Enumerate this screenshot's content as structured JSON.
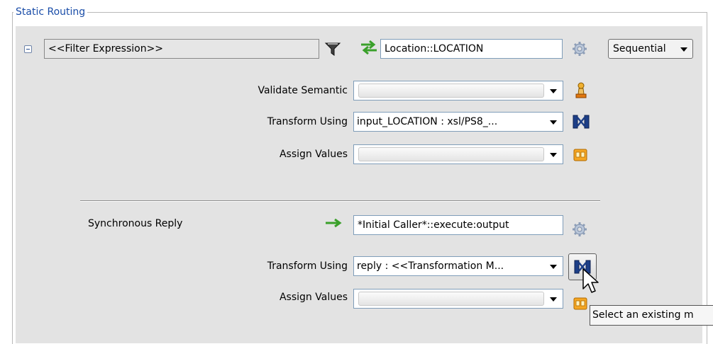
{
  "group": {
    "title": "Static Routing"
  },
  "rule": {
    "filter_expression": "<<Filter Expression>>",
    "target_service": "Location::LOCATION",
    "execution_mode": "Sequential",
    "validate_semantic": {
      "label": "Validate Semantic",
      "value": ""
    },
    "transform": {
      "label": "Transform Using",
      "value": "input_LOCATION : xsl/PS8_..."
    },
    "assign": {
      "label": "Assign Values",
      "value": ""
    }
  },
  "reply": {
    "label": "Synchronous Reply",
    "target": "*Initial Caller*::execute:output",
    "transform": {
      "label": "Transform Using",
      "value": "reply : <<Transformation M..."
    },
    "assign": {
      "label": "Assign Values",
      "value": ""
    }
  },
  "tooltip": {
    "text": "Select an existing m"
  },
  "icons": {
    "collapse": "collapse-toggle-icon",
    "filter": "filter-funnel-icon",
    "route": "green-swap-arrows-icon",
    "settings": "gear-icon",
    "validate": "schematron-validate-icon",
    "transform": "xsl-mapper-icon",
    "assign": "assign-values-icon",
    "reply": "green-right-arrow-icon",
    "cursor": "mouse-pointer-icon"
  }
}
